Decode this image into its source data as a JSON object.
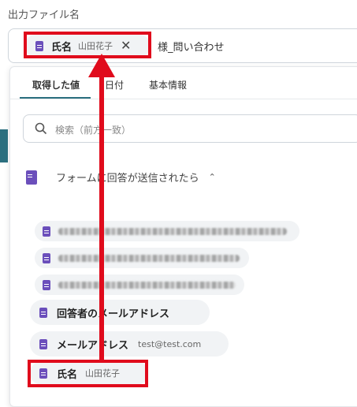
{
  "field": {
    "label": "出力ファイル名",
    "token": {
      "name": "氏名",
      "value": "山田花子"
    },
    "suffix_text": "様_問い合わせ"
  },
  "panel": {
    "tabs": [
      {
        "label": "取得した値",
        "active": true
      },
      {
        "label": "日付",
        "active": false
      },
      {
        "label": "基本情報",
        "active": false
      }
    ],
    "search": {
      "placeholder": "検索（前方一致）"
    },
    "group": {
      "title": "フォームに回答が送信されたら"
    },
    "items": [
      {
        "name": "回答者のメールアドレス",
        "value": ""
      },
      {
        "name": "メールアドレス",
        "value": "test@test.com"
      },
      {
        "name": "氏名",
        "value": "山田花子"
      }
    ]
  },
  "colors": {
    "accent": "#2b6f7f",
    "form_icon": "#6b4fbb",
    "highlight": "#e00b1c"
  }
}
